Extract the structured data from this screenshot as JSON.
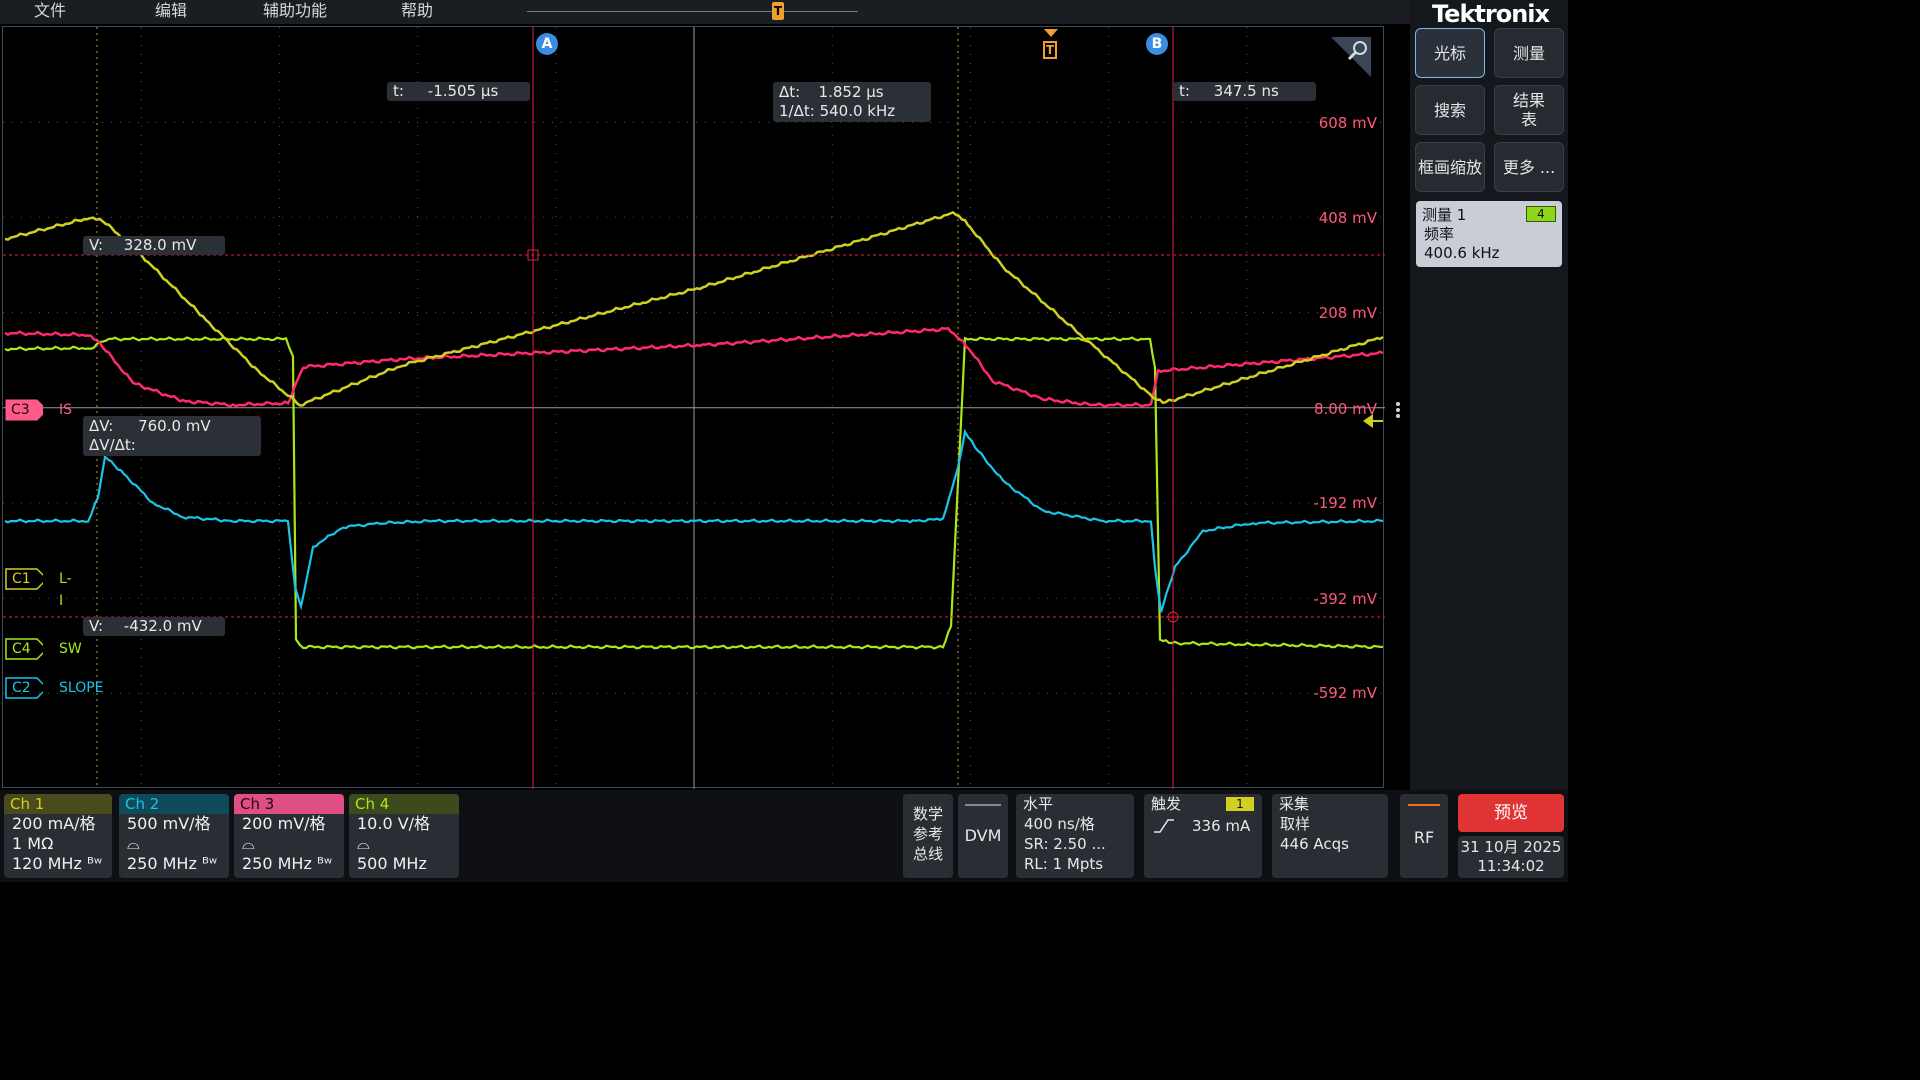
{
  "menu": {
    "items": [
      "文件",
      "编辑",
      "辅助功能",
      "帮助"
    ]
  },
  "brand": "Tektronix",
  "colors": {
    "ch1": "#cfd020",
    "ch2": "#19c5e8",
    "ch3": "#ff2a6a",
    "ch4": "#a8e81a",
    "cursor": "#e02040",
    "trigger": "#f0a030"
  },
  "cursors": {
    "a_label": "A",
    "b_label": "B",
    "trigger_label": "T",
    "a_time": {
      "label": "t:",
      "value": "-1.505 µs"
    },
    "b_time": {
      "label": "t:",
      "value": "347.5 ns"
    },
    "delta": {
      "dt_label": "Δt:",
      "dt_value": "1.852 µs",
      "inv_label": "1/Δt:",
      "inv_value": "540.0 kHz"
    },
    "v_a": {
      "label": "V:",
      "value": "328.0 mV"
    },
    "v_b": {
      "label": "V:",
      "value": "-432.0 mV"
    },
    "dv": {
      "dv_label": "ΔV:",
      "dv_value": "760.0 mV",
      "dvdt_label": "ΔV/Δt:"
    }
  },
  "scale_labels": [
    "608 mV",
    "408 mV",
    "208 mV",
    "8.00 mV",
    "-192 mV",
    "-392 mV",
    "-592 mV"
  ],
  "channel_tags": [
    {
      "tag": "C3",
      "name": "IS"
    },
    {
      "tag": "C1",
      "name": "L-I"
    },
    {
      "tag": "C4",
      "name": "SW"
    },
    {
      "tag": "C2",
      "name": "SLOPE"
    }
  ],
  "right_panel": {
    "buttons": [
      "光标",
      "测量",
      "搜索",
      "结果\n表",
      "框画缩放",
      "更多 ..."
    ],
    "measurement": {
      "title": "测量 1",
      "channel": "4",
      "type": "频率",
      "value": "400.6 kHz"
    }
  },
  "bottom": {
    "channels": [
      {
        "header": "Ch 1",
        "lines": [
          "200 mA/格",
          "1 MΩ",
          "120 MHz ᴮʷ"
        ]
      },
      {
        "header": "Ch 2",
        "lines": [
          "500 mV/格",
          "⌓",
          "250 MHz ᴮʷ"
        ]
      },
      {
        "header": "Ch 3",
        "lines": [
          "200 mV/格",
          "⌓",
          "250 MHz ᴮʷ"
        ]
      },
      {
        "header": "Ch 4",
        "lines": [
          "10.0 V/格",
          "⌓",
          "500 MHz"
        ]
      }
    ],
    "math_ref_bus": [
      "数学",
      "参考",
      "总线"
    ],
    "dvm": "DVM",
    "horizontal": {
      "header": "水平",
      "lines": [
        "400 ns/格",
        "SR: 2.50 ...",
        "RL: 1 Mpts"
      ]
    },
    "trigger": {
      "header": "触发",
      "channel": "1",
      "level": "336 mA"
    },
    "acquire": {
      "header": "采集",
      "lines": [
        "取样",
        "446 Acqs"
      ]
    },
    "rf": "RF",
    "preview": "预览",
    "date": "31 10月 2025",
    "time": "11:34:02"
  }
}
